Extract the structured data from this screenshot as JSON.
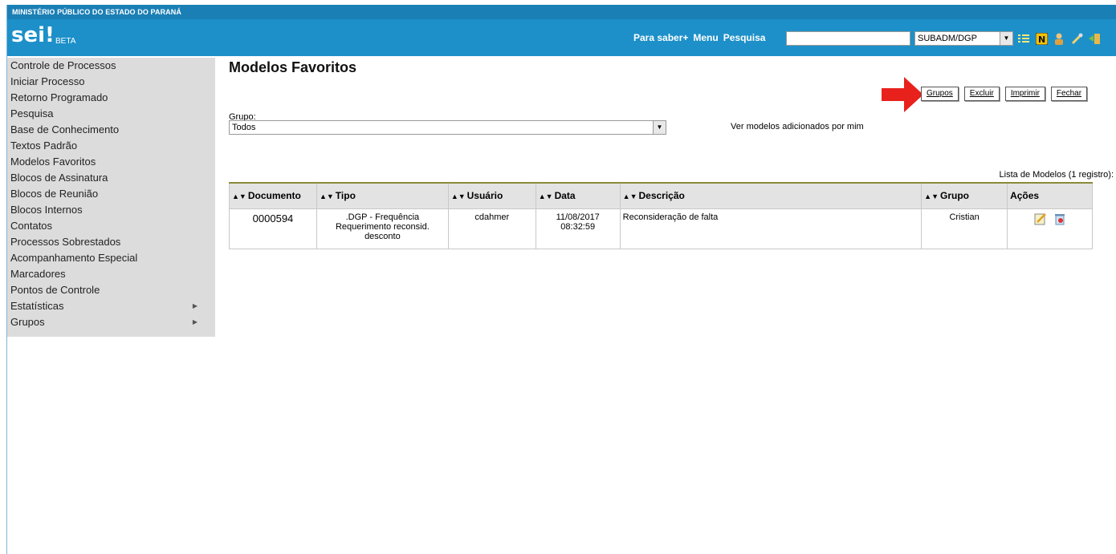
{
  "app": {
    "org_title": "MINISTÉRIO PÚBLICO DO ESTADO DO PARANÁ",
    "logo_text": "sei",
    "logo_excl": "!",
    "logo_badge": "BETA"
  },
  "header": {
    "links": [
      "Para saber+",
      "Menu",
      "Pesquisa"
    ],
    "search_value": "",
    "unit_select": "SUBADM/DGP",
    "icons": [
      "list-icon",
      "notification-icon",
      "user-icon",
      "tools-icon",
      "exit-icon"
    ]
  },
  "sidebar": {
    "items": [
      {
        "label": "Controle de Processos"
      },
      {
        "label": "Iniciar Processo"
      },
      {
        "label": "Retorno Programado"
      },
      {
        "label": "Pesquisa"
      },
      {
        "label": "Base de Conhecimento"
      },
      {
        "label": "Textos Padrão"
      },
      {
        "label": "Modelos Favoritos"
      },
      {
        "label": "Blocos de Assinatura"
      },
      {
        "label": "Blocos de Reunião"
      },
      {
        "label": "Blocos Internos"
      },
      {
        "label": "Contatos"
      },
      {
        "label": "Processos Sobrestados"
      },
      {
        "label": "Acompanhamento Especial"
      },
      {
        "label": "Marcadores"
      },
      {
        "label": "Pontos de Controle"
      },
      {
        "label": "Estatísticas"
      },
      {
        "label": "Grupos"
      }
    ]
  },
  "main": {
    "title": "Modelos Favoritos",
    "buttons": {
      "grupos": "Grupos",
      "excluir": "Excluir",
      "imprimir": "Imprimir",
      "fechar": "Fechar"
    },
    "group_label": "Grupo:",
    "group_value": "Todos",
    "ver_link": "Ver modelos adicionados por mim",
    "list_caption": "Lista de Modelos (1 registro):",
    "table": {
      "headers": [
        "Documento",
        "Tipo",
        "Usuário",
        "Data",
        "Descrição",
        "Grupo",
        "Ações"
      ],
      "rows": [
        {
          "documento": "0000594",
          "tipo": ".DGP - Frequência Requerimento reconsid. desconto",
          "usuario": "cdahmer",
          "data": "11/08/2017",
          "hora": "08:32:59",
          "descricao": "Reconsideração de falta",
          "grupo": "Cristian"
        }
      ]
    }
  },
  "colors": {
    "top_bar": "#1a7fb5",
    "header": "#1d90c9",
    "sidebar": "#dcdcdc",
    "arrow": "#e8211d"
  }
}
